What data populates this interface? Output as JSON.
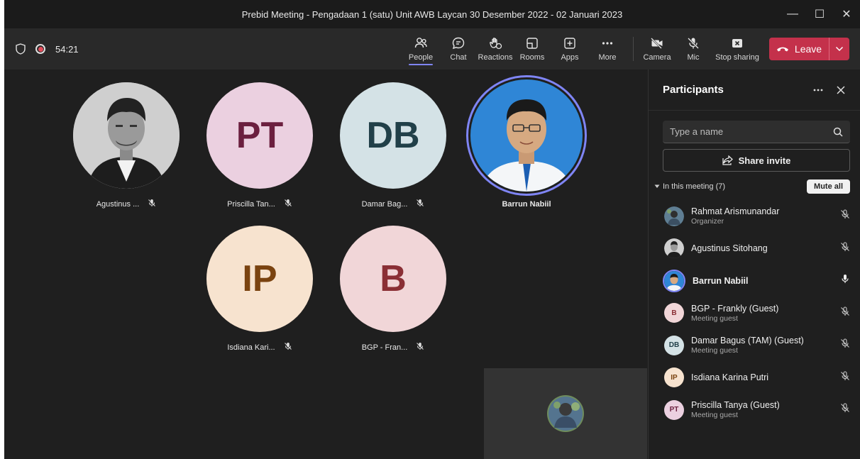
{
  "window": {
    "title": "Prebid Meeting - Pengadaan 1 (satu) Unit AWB Laycan 30 Desember 2022 - 02 Januari 2023",
    "minimize": "—",
    "maximize": "☐",
    "close": "✕"
  },
  "toolbar": {
    "timer": "54:21",
    "people": "People",
    "chat": "Chat",
    "reactions": "Reactions",
    "rooms": "Rooms",
    "apps": "Apps",
    "more": "More",
    "camera": "Camera",
    "mic": "Mic",
    "stop_sharing": "Stop sharing",
    "leave": "Leave"
  },
  "stage": {
    "tiles": [
      {
        "name": "Agustinus ...",
        "initials": ""
      },
      {
        "name": "Priscilla Tan...",
        "initials": "PT"
      },
      {
        "name": "Damar Bag...",
        "initials": "DB"
      },
      {
        "name": "Barrun Nabiil",
        "initials": ""
      },
      {
        "name": "Isdiana Kari...",
        "initials": "IP"
      },
      {
        "name": "BGP - Fran...",
        "initials": "B"
      }
    ]
  },
  "panel": {
    "title": "Participants",
    "search_placeholder": "Type a name",
    "share_invite": "Share invite",
    "section_label": "In this meeting (7)",
    "mute_all": "Mute all",
    "participants": [
      {
        "name": "Rahmat Arismunandar",
        "role": "Organizer",
        "initials": ""
      },
      {
        "name": "Agustinus Sitohang",
        "role": "",
        "initials": ""
      },
      {
        "name": "Barrun Nabiil",
        "role": "",
        "initials": ""
      },
      {
        "name": "BGP - Frankly (Guest)",
        "role": "Meeting guest",
        "initials": "B"
      },
      {
        "name": "Damar Bagus (TAM) (Guest)",
        "role": "Meeting guest",
        "initials": "DB"
      },
      {
        "name": "Isdiana Karina Putri",
        "role": "",
        "initials": "IP"
      },
      {
        "name": "Priscilla Tanya (Guest)",
        "role": "Meeting guest",
        "initials": "PT"
      }
    ]
  },
  "colors": {
    "leave_red": "#c4314b",
    "accent": "#7f85f5",
    "pt_bg": "#ebd0e0",
    "pt_fg": "#6b1f3f",
    "db_bg": "#d4e2e6",
    "db_fg": "#214049",
    "ip_bg": "#f7e3cf",
    "ip_fg": "#7a4310",
    "b_bg": "#f1d6d8",
    "b_fg": "#8a2f35"
  }
}
